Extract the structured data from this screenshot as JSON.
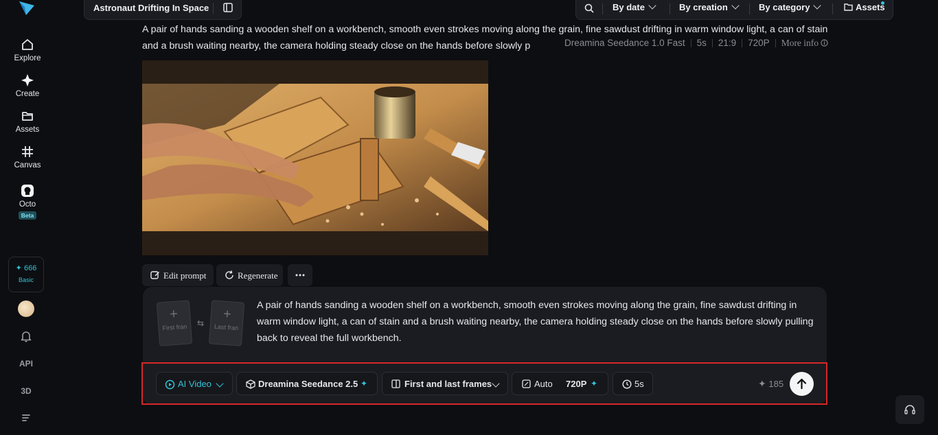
{
  "sidebar": {
    "items": [
      {
        "label": "Explore",
        "icon": "home-icon"
      },
      {
        "label": "Create",
        "icon": "sparkle-icon"
      },
      {
        "label": "Assets",
        "icon": "folder-icon"
      },
      {
        "label": "Canvas",
        "icon": "grid-icon"
      },
      {
        "label": "Octo",
        "icon": "octo-icon",
        "badge": "Beta"
      }
    ],
    "credits": {
      "value": "666",
      "plan": "Basic"
    },
    "api_label": "API",
    "threed_label": "3D"
  },
  "header": {
    "project_title": "Astronaut Drifting In Space",
    "filters": [
      "By date",
      "By creation",
      "By category"
    ],
    "assets_label": "Assets"
  },
  "result": {
    "prompt": "A pair of hands sanding a wooden shelf on a workbench, smooth even strokes moving along the grain, fine sawdust drifting in warm window light, a can of stain and a brush waiting nearby, the camera holding steady close on the hands before slowly p",
    "meta": {
      "model": "Dreamina Seedance 1.0 Fast",
      "duration": "5s",
      "ratio": "21:9",
      "resolution": "720P",
      "more": "More info"
    },
    "actions": {
      "edit": "Edit prompt",
      "regenerate": "Regenerate"
    }
  },
  "composer": {
    "first_frame": "First fran",
    "last_frame": "Last fran",
    "prompt": "A pair of hands sanding a wooden shelf on a workbench, smooth even strokes moving along the grain, fine sawdust drifting in warm window light, a can of stain and a brush waiting nearby, the camera holding steady close on the hands before slowly pulling back to reveal the full workbench.",
    "mode": "AI Video",
    "model": "Dreamina Seedance 2.5",
    "frames_mode": "First and last frames",
    "ratio": "Auto",
    "resolution": "720P",
    "duration": "5s",
    "cost": "185"
  },
  "colors": {
    "accent": "#33c3d6",
    "highlight": "#d62828",
    "background": "#0d0e11",
    "panel": "#1b1c21"
  }
}
